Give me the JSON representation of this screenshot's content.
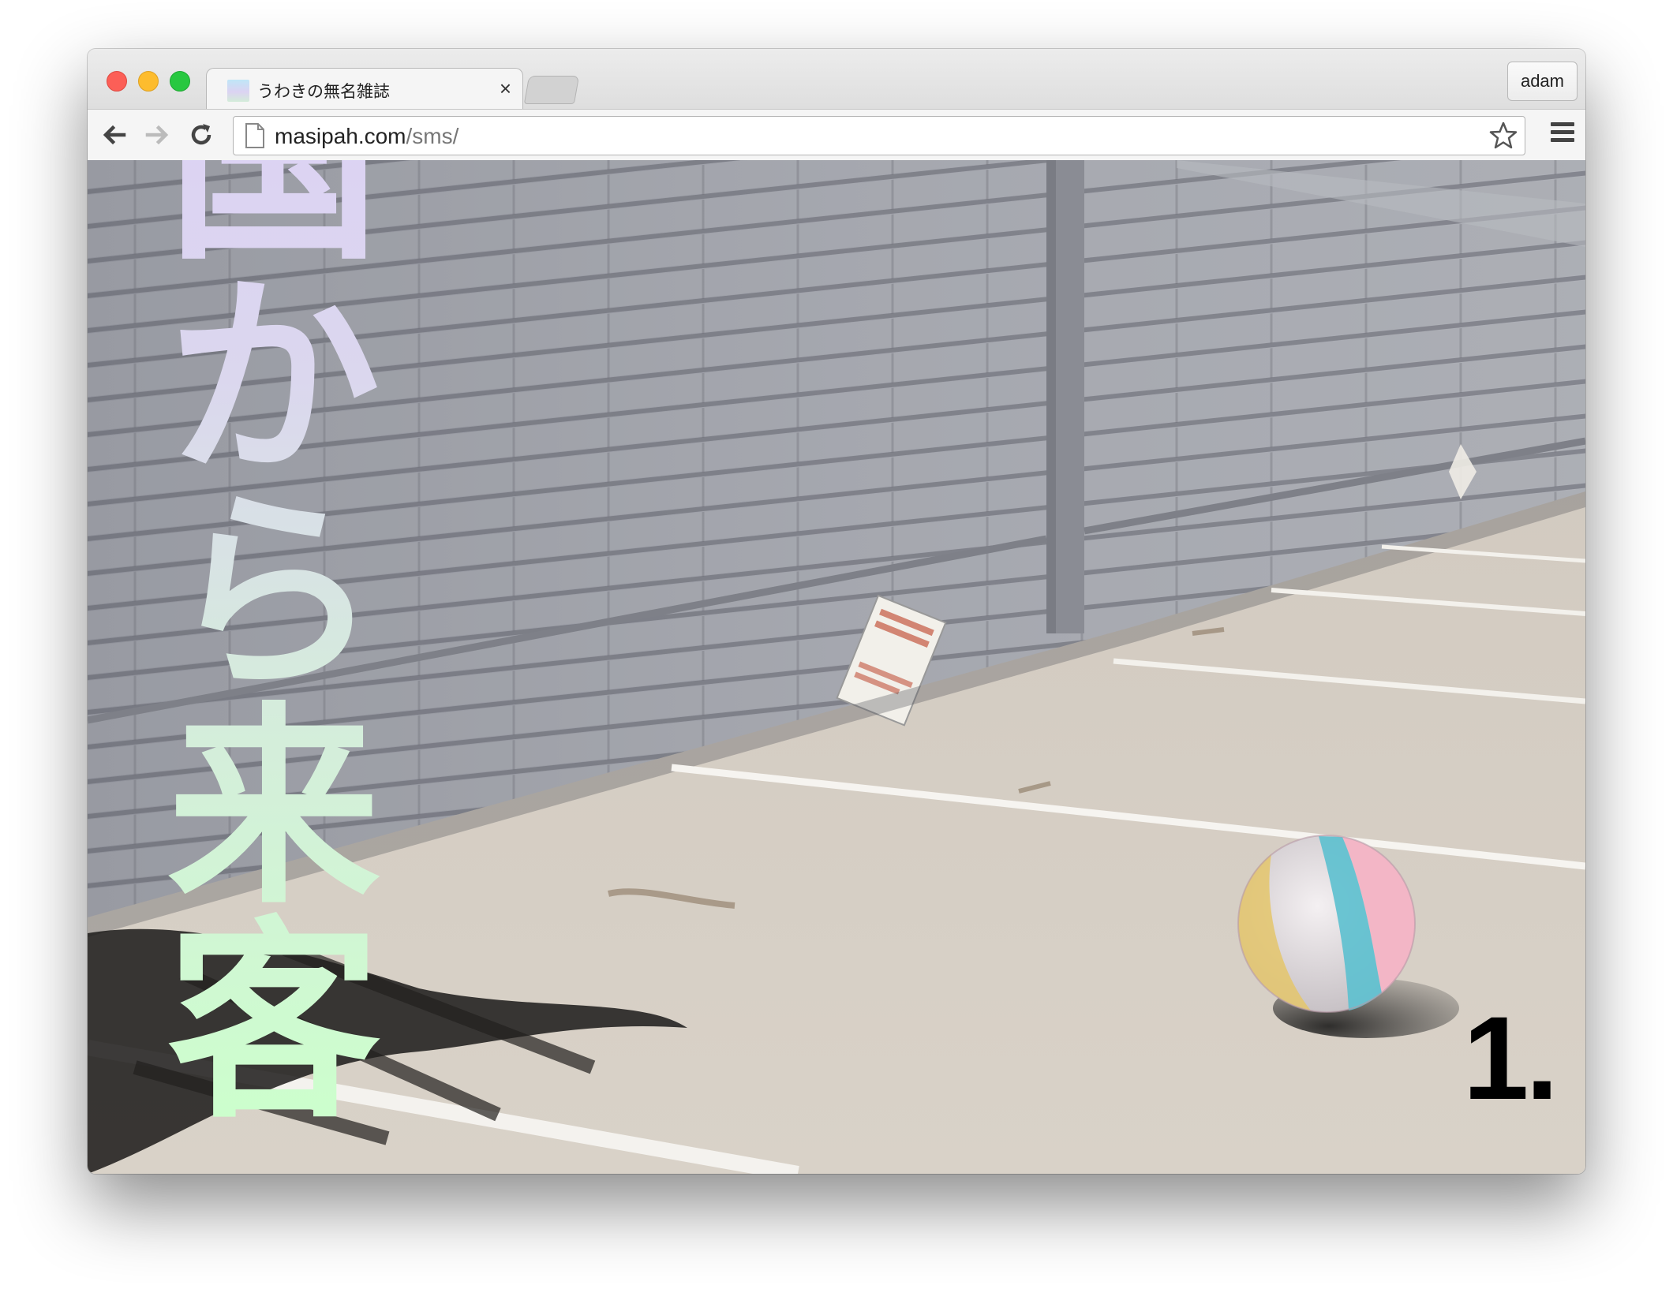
{
  "browser": {
    "tab": {
      "title": "うわきの無名雑誌",
      "close_glyph": "×"
    },
    "profile": "adam",
    "url": {
      "domain": "masipah.com",
      "path": "/sms/"
    }
  },
  "page": {
    "vertical_title": [
      "国",
      "か",
      "ら",
      "来",
      "客"
    ],
    "issue_number": "1."
  },
  "colors": {
    "title_gradient": [
      "#dcd1f5",
      "#ccffcc"
    ],
    "wall": "#9ea0a8",
    "pavement": "#d2c9be"
  }
}
